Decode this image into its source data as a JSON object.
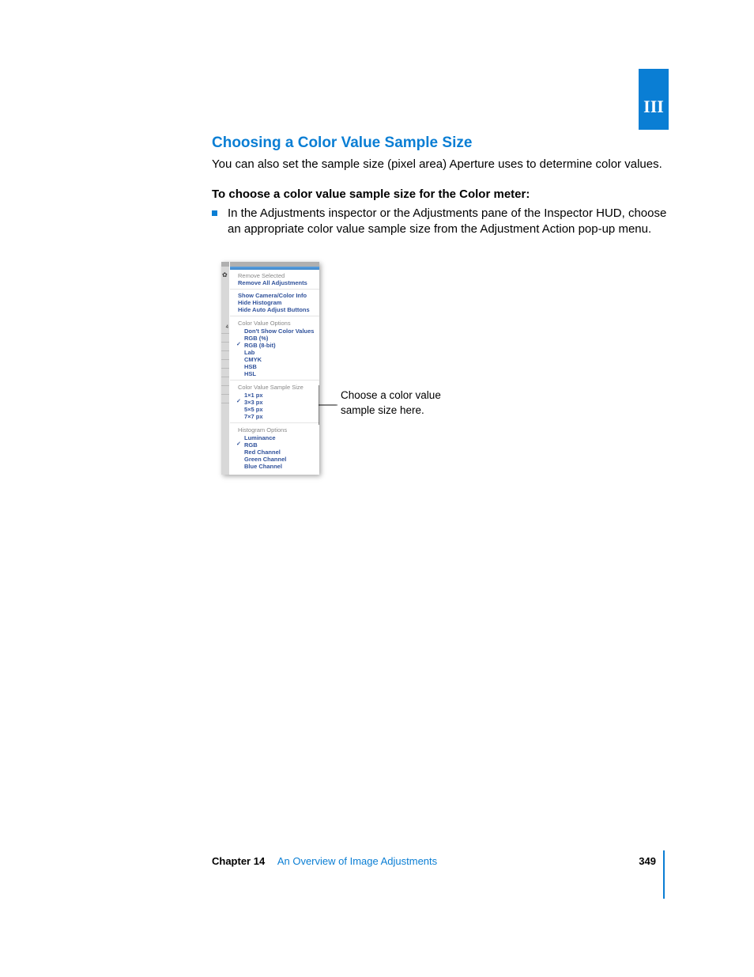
{
  "part_label": "III",
  "heading": "Choosing a Color Value Sample Size",
  "intro": "You can also set the sample size (pixel area) Aperture uses to determine color values.",
  "step_intro": "To choose a color value sample size for the Color meter:",
  "step_text": "In the Adjustments inspector or the Adjustments pane of the Inspector HUD, choose an appropriate color value sample size from the Adjustment Action pop-up menu.",
  "callout_line1": "Choose a color value",
  "callout_line2": "sample size here.",
  "menu": {
    "top": [
      "Remove Selected",
      "Remove All Adjustments"
    ],
    "info": [
      "Show Camera/Color Info",
      "Hide Histogram",
      "Hide Auto Adjust Buttons"
    ],
    "color_value_header": "Color Value Options",
    "color_value_items": [
      {
        "label": "Don't Show Color Values",
        "checked": false
      },
      {
        "label": "RGB (%)",
        "checked": false
      },
      {
        "label": "RGB (8-bit)",
        "checked": true
      },
      {
        "label": "Lab",
        "checked": false
      },
      {
        "label": "CMYK",
        "checked": false
      },
      {
        "label": "HSB",
        "checked": false
      },
      {
        "label": "HSL",
        "checked": false
      }
    ],
    "sample_size_header": "Color Value Sample Size",
    "sample_size_items": [
      {
        "label": "1×1 px",
        "checked": false
      },
      {
        "label": "3×3 px",
        "checked": true
      },
      {
        "label": "5×5 px",
        "checked": false
      },
      {
        "label": "7×7 px",
        "checked": false
      }
    ],
    "hist_header": "Histogram Options",
    "hist_items": [
      {
        "label": "Luminance",
        "checked": false
      },
      {
        "label": "RGB",
        "checked": true
      },
      {
        "label": "Red Channel",
        "checked": false
      },
      {
        "label": "Green Channel",
        "checked": false
      },
      {
        "label": "Blue Channel",
        "checked": false
      }
    ]
  },
  "footer": {
    "chapter": "Chapter 14",
    "title": "An Overview of Image Adjustments",
    "page": "349"
  }
}
